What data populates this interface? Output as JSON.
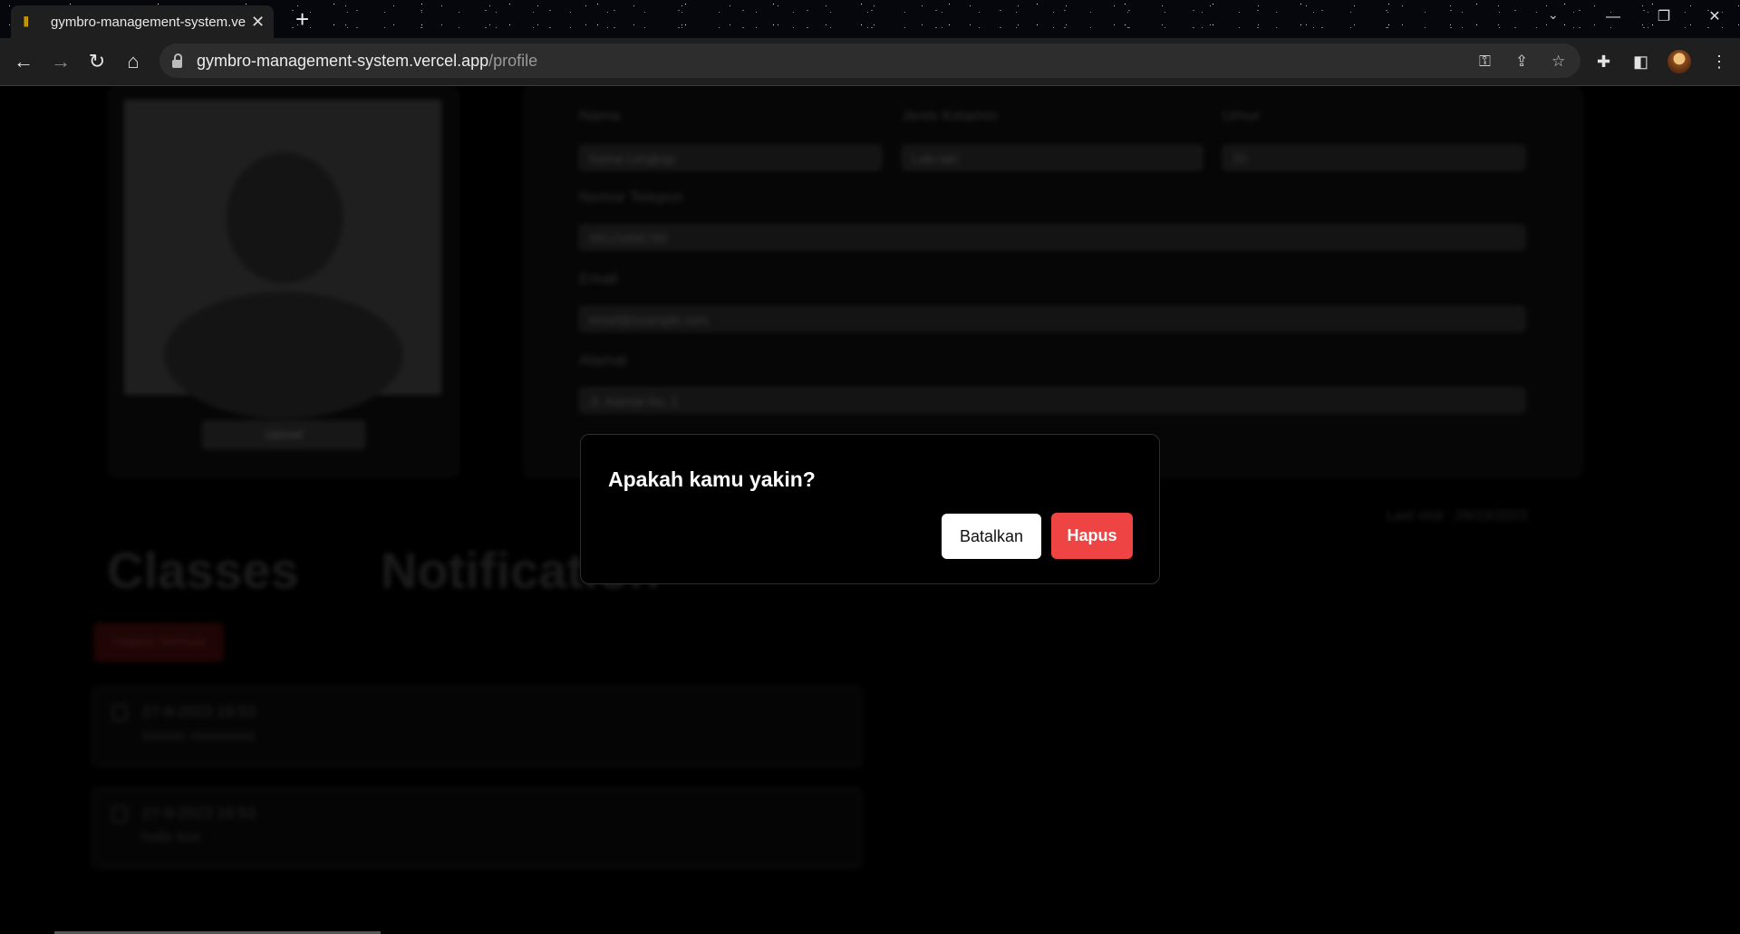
{
  "browser": {
    "tab_title": "gymbro-management-system.vercel.app",
    "tab_favicon": "dumbbell-favicon",
    "url_host": "gymbro-management-system.vercel.app",
    "url_path": "/profile",
    "icons": [
      "back-icon",
      "forward-icon",
      "reload-icon",
      "home-icon",
      "lock-icon",
      "key-icon",
      "share-icon",
      "star-icon",
      "extensions-icon",
      "side-panel-icon",
      "avatar",
      "menu-icon"
    ]
  },
  "profile": {
    "upload_label": "Upload",
    "fields": {
      "name_label": "Nama",
      "name_value": "Nama Lengkap",
      "gender_label": "Jenis Kelamin",
      "gender_value": "Laki-laki",
      "age_label": "Umur",
      "age_value": "20",
      "phone_label": "Nomor Telepon",
      "phone_value": "08123456789",
      "email_label": "Email",
      "email_value": "email@example.com",
      "address_label": "Alamat",
      "address_value": "Jl. Alamat No. 1"
    },
    "last_login": "Last visit : 29/10/2023"
  },
  "sections": {
    "classes": "Classes",
    "notification": "Notification",
    "delete_all": "Hapus Semua"
  },
  "notifications": [
    {
      "date": "27-9-2023 18:53",
      "message": "ssssss sssssssss"
    },
    {
      "date": "27-9-2023 18:53",
      "message": "hallo test"
    }
  ],
  "dialog": {
    "title": "Apakah kamu yakin?",
    "cancel_label": "Batalkan",
    "delete_label": "Hapus",
    "delete_color": "#ef4444"
  }
}
